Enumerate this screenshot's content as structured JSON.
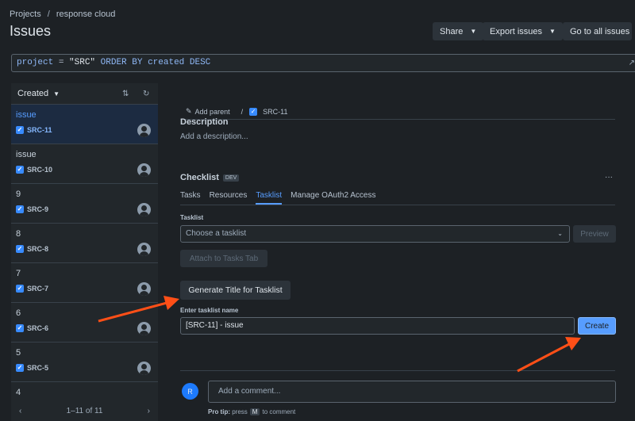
{
  "breadcrumb": {
    "project": "Projects",
    "name": "response cloud"
  },
  "page_title": "Issues",
  "header_buttons": {
    "share": "Share",
    "export": "Export issues",
    "go_all": "Go to all issues"
  },
  "jql": {
    "p1": "project",
    "p2": " = ",
    "p3": "\"SRC\"",
    "p4": " ORDER BY ",
    "p5": "created",
    "p6": " DESC"
  },
  "list": {
    "sort_label": "Created",
    "items": [
      {
        "title": "issue",
        "key": "SRC-11"
      },
      {
        "title": "issue",
        "key": "SRC-10"
      },
      {
        "title": "9",
        "key": "SRC-9"
      },
      {
        "title": "8",
        "key": "SRC-8"
      },
      {
        "title": "7",
        "key": "SRC-7"
      },
      {
        "title": "6",
        "key": "SRC-6"
      },
      {
        "title": "5",
        "key": "SRC-5"
      },
      {
        "title": "4",
        "key": ""
      }
    ],
    "pager": "1–11 of 11"
  },
  "detail": {
    "add_parent": "Add parent",
    "key": "SRC-11",
    "description_title": "Description",
    "description_placeholder": "Add a description...",
    "checklist_title": "Checklist",
    "checklist_badge": "DEV",
    "more": "···",
    "tabs": [
      "Tasks",
      "Resources",
      "Tasklist",
      "Manage OAuth2 Access"
    ],
    "tasklist_label": "Tasklist",
    "tasklist_placeholder": "Choose a tasklist",
    "preview": "Preview",
    "attach": "Attach to Tasks Tab",
    "generate": "Generate Title for Tasklist",
    "name_label": "Enter tasklist name",
    "name_value": "[SRC-11] - issue",
    "create": "Create",
    "user_initial": "R",
    "comment_placeholder": "Add a comment...",
    "protip_prefix": "Pro tip:",
    "protip_mid": "press",
    "protip_key": "M",
    "protip_suffix": "to comment"
  },
  "colors": {
    "accent": "#579dff",
    "arrow": "#ff4f17",
    "background": "#1d2125"
  }
}
